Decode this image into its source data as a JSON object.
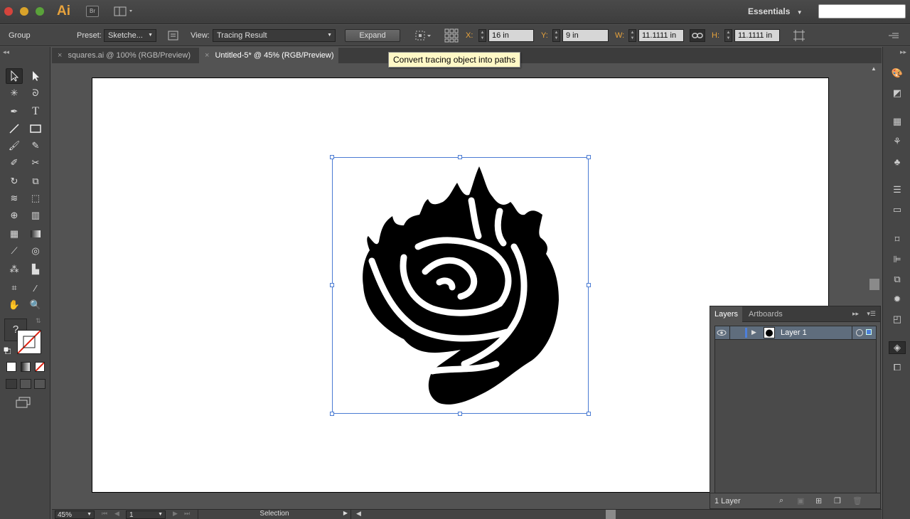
{
  "app": {
    "logo": "Ai",
    "bridge": "Br",
    "workspace": "Essentials"
  },
  "control_bar": {
    "selection_type": "Group",
    "preset_label": "Preset:",
    "preset_value": "Sketche...",
    "view_label": "View:",
    "view_value": "Tracing Result",
    "expand_button": "Expand",
    "x_label": "X:",
    "x_value": "16 in",
    "y_label": "Y:",
    "y_value": "9 in",
    "w_label": "W:",
    "w_value": "11.1111 in",
    "h_label": "H:",
    "h_value": "11.1111 in"
  },
  "tabs": [
    {
      "label": "squares.ai @ 100% (RGB/Preview)"
    },
    {
      "label": "Untitled-5* @ 45% (RGB/Preview)"
    }
  ],
  "tooltip": "Convert tracing object into paths",
  "tools": {
    "fill_stroke_help": "?"
  },
  "layers_panel": {
    "tabs": [
      "Layers",
      "Artboards"
    ],
    "layer_name": "Layer 1",
    "footer_count": "1 Layer"
  },
  "status_bar": {
    "zoom": "45%",
    "artboard_number": "1",
    "tool_name": "Selection"
  }
}
